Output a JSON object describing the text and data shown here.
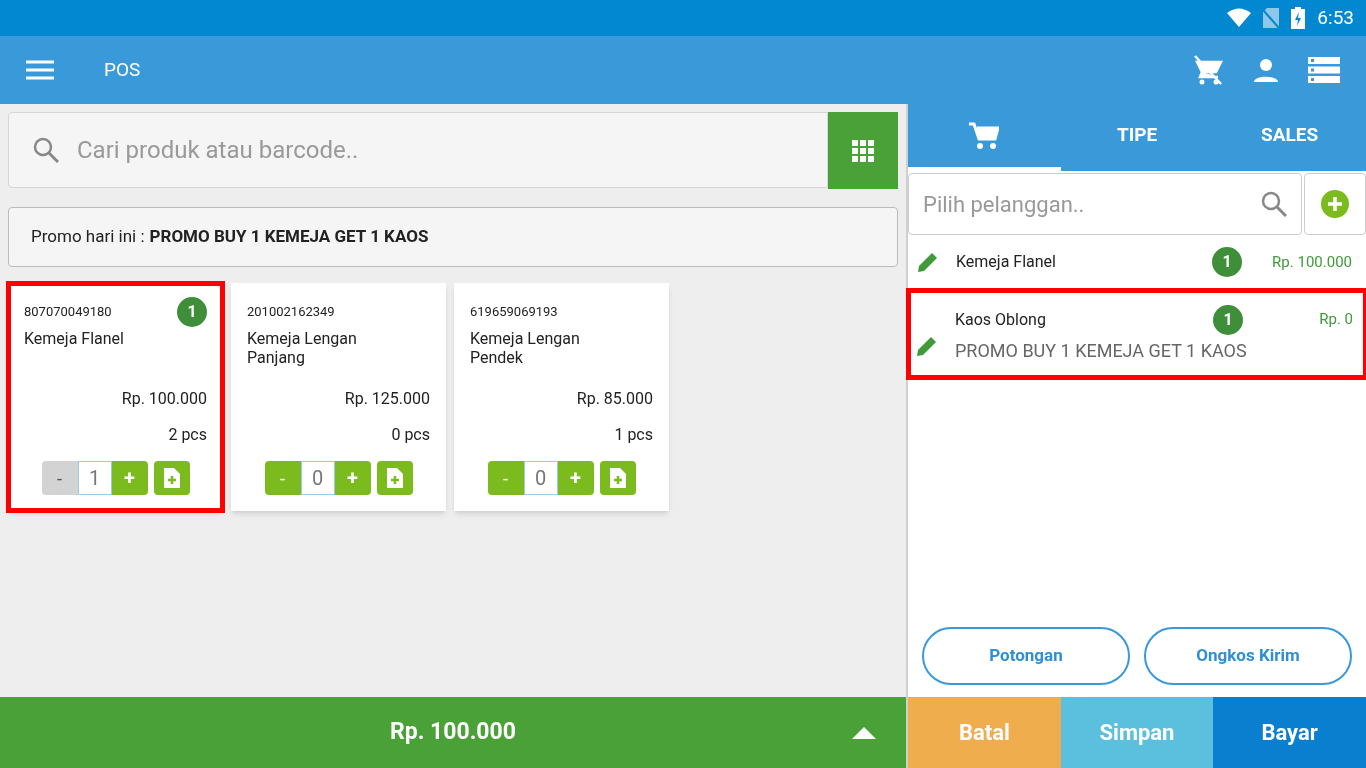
{
  "status_bar": {
    "time": "6:53"
  },
  "app_bar": {
    "title": "POS"
  },
  "search": {
    "placeholder": "Cari produk atau barcode.."
  },
  "promo": {
    "label": "Promo hari ini :",
    "name": "PROMO BUY 1 KEMEJA GET 1 KAOS"
  },
  "products": [
    {
      "barcode": "807070049180",
      "badge": "1",
      "name": "Kemeja Flanel",
      "price": "Rp. 100.000",
      "stock": "2 pcs",
      "minus": "-",
      "qty": "1",
      "plus": "+",
      "minus_disabled": true,
      "highlighted": true
    },
    {
      "barcode": "201002162349",
      "name": "Kemeja Lengan Panjang",
      "price": "Rp. 125.000",
      "stock": "0 pcs",
      "minus": "-",
      "qty": "0",
      "plus": "+",
      "minus_disabled": false,
      "highlighted": false
    },
    {
      "barcode": "619659069193",
      "name": "Kemeja Lengan Pendek",
      "price": "Rp. 85.000",
      "stock": "1 pcs",
      "minus": "-",
      "qty": "0",
      "plus": "+",
      "minus_disabled": false,
      "highlighted": false
    }
  ],
  "total_bar": {
    "total": "Rp. 100.000"
  },
  "tabs": [
    {
      "kind": "icon",
      "selected": true
    },
    {
      "kind": "text",
      "label": "TIPE",
      "selected": false
    },
    {
      "kind": "text",
      "label": "SALES",
      "selected": false
    }
  ],
  "customer": {
    "placeholder": "Pilih pelanggan.."
  },
  "cart": [
    {
      "name": "Kemeja Flanel",
      "qty": "1",
      "price": "Rp. 100.000",
      "highlighted": false
    },
    {
      "name": "Kaos Oblong",
      "qty": "1",
      "price": "Rp. 0",
      "promo": "PROMO BUY 1 KEMEJA GET 1 KAOS",
      "highlighted": true
    }
  ],
  "extra_buttons": [
    "Potongan",
    "Ongkos Kirim"
  ],
  "actions": [
    {
      "label": "Batal",
      "color": "#f0ad4e"
    },
    {
      "label": "Simpan",
      "color": "#5bc0de"
    },
    {
      "label": "Bayar",
      "color": "#0a7fd0"
    }
  ]
}
